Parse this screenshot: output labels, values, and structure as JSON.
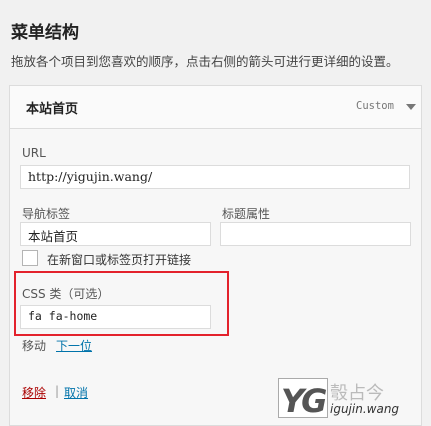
{
  "page": {
    "title": "菜单结构",
    "hint": "拖放各个项目到您喜欢的顺序，点击右侧的箭头可进行更详细的设置。"
  },
  "menu_item": {
    "title": "本站首页",
    "type": "Custom",
    "url_label": "URL",
    "url_value": "http://yigujin.wang/",
    "nav_label": "导航标签",
    "nav_value": "本站首页",
    "title_attr_label": "标题属性",
    "title_attr_value": "",
    "new_window_label": "在新窗口或标签页打开链接",
    "new_window_checked": false,
    "css_label": "CSS 类（可选）",
    "css_value": "fa fa-home",
    "move_label": "移动",
    "move_down": "下一位",
    "remove": "移除",
    "separator": "|",
    "cancel": "取消"
  },
  "watermark": {
    "logo": "YG",
    "text": "彀占今",
    "url": "igujin.wang"
  },
  "colors": {
    "highlight_border": "#e3222c",
    "link": "#0073aa",
    "remove": "#aa0000"
  }
}
